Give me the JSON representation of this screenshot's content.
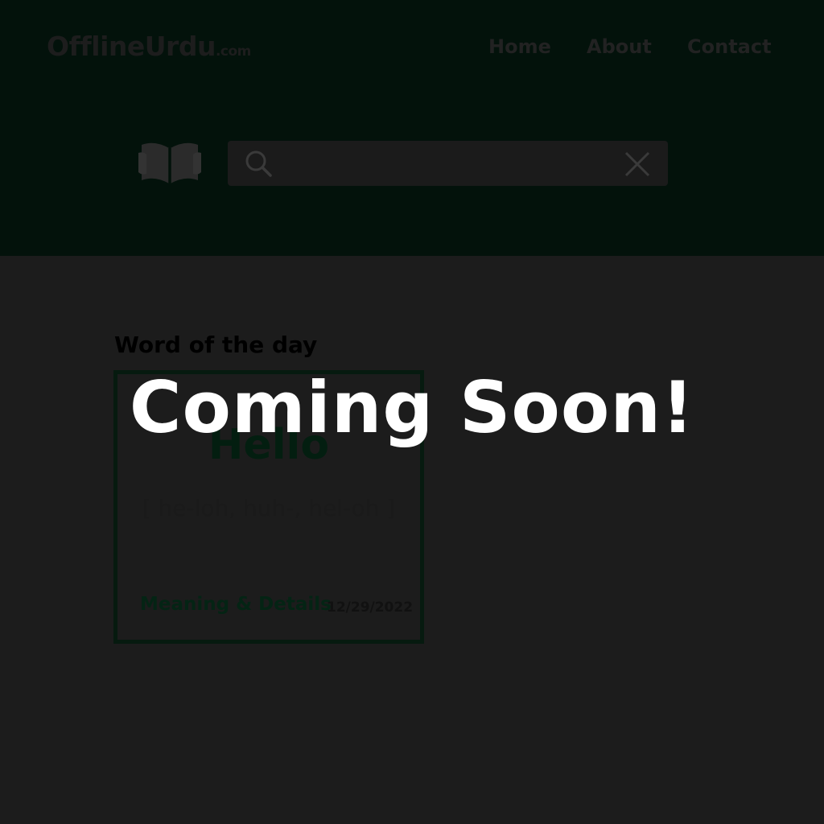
{
  "header": {
    "logo_main": "OfflineUrdu",
    "logo_tld": ".com",
    "nav": {
      "home": "Home",
      "about": "About",
      "contact": "Contact"
    }
  },
  "search": {
    "value": "",
    "placeholder": ""
  },
  "word_of_day": {
    "title": "Word of the day",
    "word": "Hello",
    "pronunciation": "[ he-loh, huh-, hel-oh ]",
    "link_label": "Meaning & Details",
    "date": "12/29/2022"
  },
  "overlay": {
    "message": "Coming Soon!"
  },
  "colors": {
    "header_bg": "#03120b",
    "page_bg": "#1c1c1c",
    "accent_green": "#042414",
    "overlay_text": "#ffffff"
  },
  "icons": {
    "book": "open-book-icon",
    "search": "search-icon",
    "clear": "close-icon"
  }
}
